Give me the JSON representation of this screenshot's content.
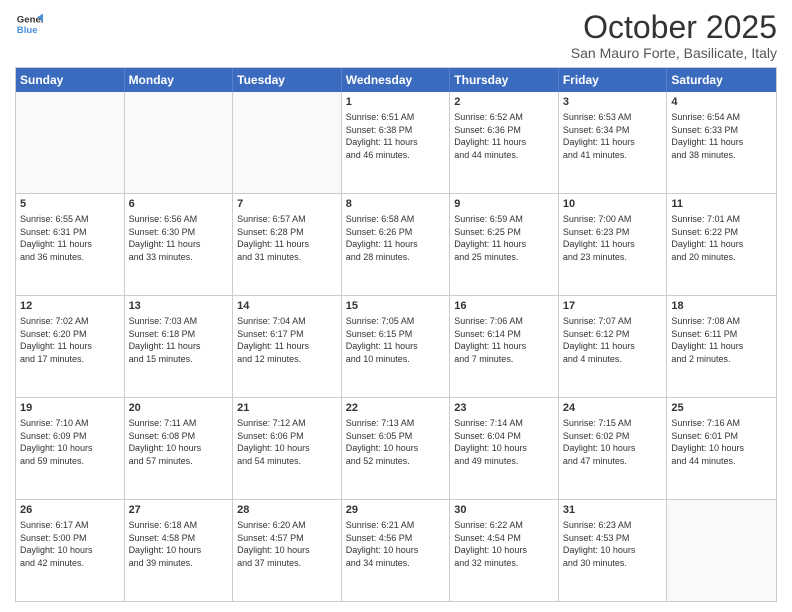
{
  "header": {
    "logo_line1": "General",
    "logo_line2": "Blue",
    "month": "October 2025",
    "location": "San Mauro Forte, Basilicate, Italy"
  },
  "dayHeaders": [
    "Sunday",
    "Monday",
    "Tuesday",
    "Wednesday",
    "Thursday",
    "Friday",
    "Saturday"
  ],
  "weeks": [
    [
      {
        "day": "",
        "info": ""
      },
      {
        "day": "",
        "info": ""
      },
      {
        "day": "",
        "info": ""
      },
      {
        "day": "1",
        "info": "Sunrise: 6:51 AM\nSunset: 6:38 PM\nDaylight: 11 hours\nand 46 minutes."
      },
      {
        "day": "2",
        "info": "Sunrise: 6:52 AM\nSunset: 6:36 PM\nDaylight: 11 hours\nand 44 minutes."
      },
      {
        "day": "3",
        "info": "Sunrise: 6:53 AM\nSunset: 6:34 PM\nDaylight: 11 hours\nand 41 minutes."
      },
      {
        "day": "4",
        "info": "Sunrise: 6:54 AM\nSunset: 6:33 PM\nDaylight: 11 hours\nand 38 minutes."
      }
    ],
    [
      {
        "day": "5",
        "info": "Sunrise: 6:55 AM\nSunset: 6:31 PM\nDaylight: 11 hours\nand 36 minutes."
      },
      {
        "day": "6",
        "info": "Sunrise: 6:56 AM\nSunset: 6:30 PM\nDaylight: 11 hours\nand 33 minutes."
      },
      {
        "day": "7",
        "info": "Sunrise: 6:57 AM\nSunset: 6:28 PM\nDaylight: 11 hours\nand 31 minutes."
      },
      {
        "day": "8",
        "info": "Sunrise: 6:58 AM\nSunset: 6:26 PM\nDaylight: 11 hours\nand 28 minutes."
      },
      {
        "day": "9",
        "info": "Sunrise: 6:59 AM\nSunset: 6:25 PM\nDaylight: 11 hours\nand 25 minutes."
      },
      {
        "day": "10",
        "info": "Sunrise: 7:00 AM\nSunset: 6:23 PM\nDaylight: 11 hours\nand 23 minutes."
      },
      {
        "day": "11",
        "info": "Sunrise: 7:01 AM\nSunset: 6:22 PM\nDaylight: 11 hours\nand 20 minutes."
      }
    ],
    [
      {
        "day": "12",
        "info": "Sunrise: 7:02 AM\nSunset: 6:20 PM\nDaylight: 11 hours\nand 17 minutes."
      },
      {
        "day": "13",
        "info": "Sunrise: 7:03 AM\nSunset: 6:18 PM\nDaylight: 11 hours\nand 15 minutes."
      },
      {
        "day": "14",
        "info": "Sunrise: 7:04 AM\nSunset: 6:17 PM\nDaylight: 11 hours\nand 12 minutes."
      },
      {
        "day": "15",
        "info": "Sunrise: 7:05 AM\nSunset: 6:15 PM\nDaylight: 11 hours\nand 10 minutes."
      },
      {
        "day": "16",
        "info": "Sunrise: 7:06 AM\nSunset: 6:14 PM\nDaylight: 11 hours\nand 7 minutes."
      },
      {
        "day": "17",
        "info": "Sunrise: 7:07 AM\nSunset: 6:12 PM\nDaylight: 11 hours\nand 4 minutes."
      },
      {
        "day": "18",
        "info": "Sunrise: 7:08 AM\nSunset: 6:11 PM\nDaylight: 11 hours\nand 2 minutes."
      }
    ],
    [
      {
        "day": "19",
        "info": "Sunrise: 7:10 AM\nSunset: 6:09 PM\nDaylight: 10 hours\nand 59 minutes."
      },
      {
        "day": "20",
        "info": "Sunrise: 7:11 AM\nSunset: 6:08 PM\nDaylight: 10 hours\nand 57 minutes."
      },
      {
        "day": "21",
        "info": "Sunrise: 7:12 AM\nSunset: 6:06 PM\nDaylight: 10 hours\nand 54 minutes."
      },
      {
        "day": "22",
        "info": "Sunrise: 7:13 AM\nSunset: 6:05 PM\nDaylight: 10 hours\nand 52 minutes."
      },
      {
        "day": "23",
        "info": "Sunrise: 7:14 AM\nSunset: 6:04 PM\nDaylight: 10 hours\nand 49 minutes."
      },
      {
        "day": "24",
        "info": "Sunrise: 7:15 AM\nSunset: 6:02 PM\nDaylight: 10 hours\nand 47 minutes."
      },
      {
        "day": "25",
        "info": "Sunrise: 7:16 AM\nSunset: 6:01 PM\nDaylight: 10 hours\nand 44 minutes."
      }
    ],
    [
      {
        "day": "26",
        "info": "Sunrise: 6:17 AM\nSunset: 5:00 PM\nDaylight: 10 hours\nand 42 minutes."
      },
      {
        "day": "27",
        "info": "Sunrise: 6:18 AM\nSunset: 4:58 PM\nDaylight: 10 hours\nand 39 minutes."
      },
      {
        "day": "28",
        "info": "Sunrise: 6:20 AM\nSunset: 4:57 PM\nDaylight: 10 hours\nand 37 minutes."
      },
      {
        "day": "29",
        "info": "Sunrise: 6:21 AM\nSunset: 4:56 PM\nDaylight: 10 hours\nand 34 minutes."
      },
      {
        "day": "30",
        "info": "Sunrise: 6:22 AM\nSunset: 4:54 PM\nDaylight: 10 hours\nand 32 minutes."
      },
      {
        "day": "31",
        "info": "Sunrise: 6:23 AM\nSunset: 4:53 PM\nDaylight: 10 hours\nand 30 minutes."
      },
      {
        "day": "",
        "info": ""
      }
    ]
  ]
}
